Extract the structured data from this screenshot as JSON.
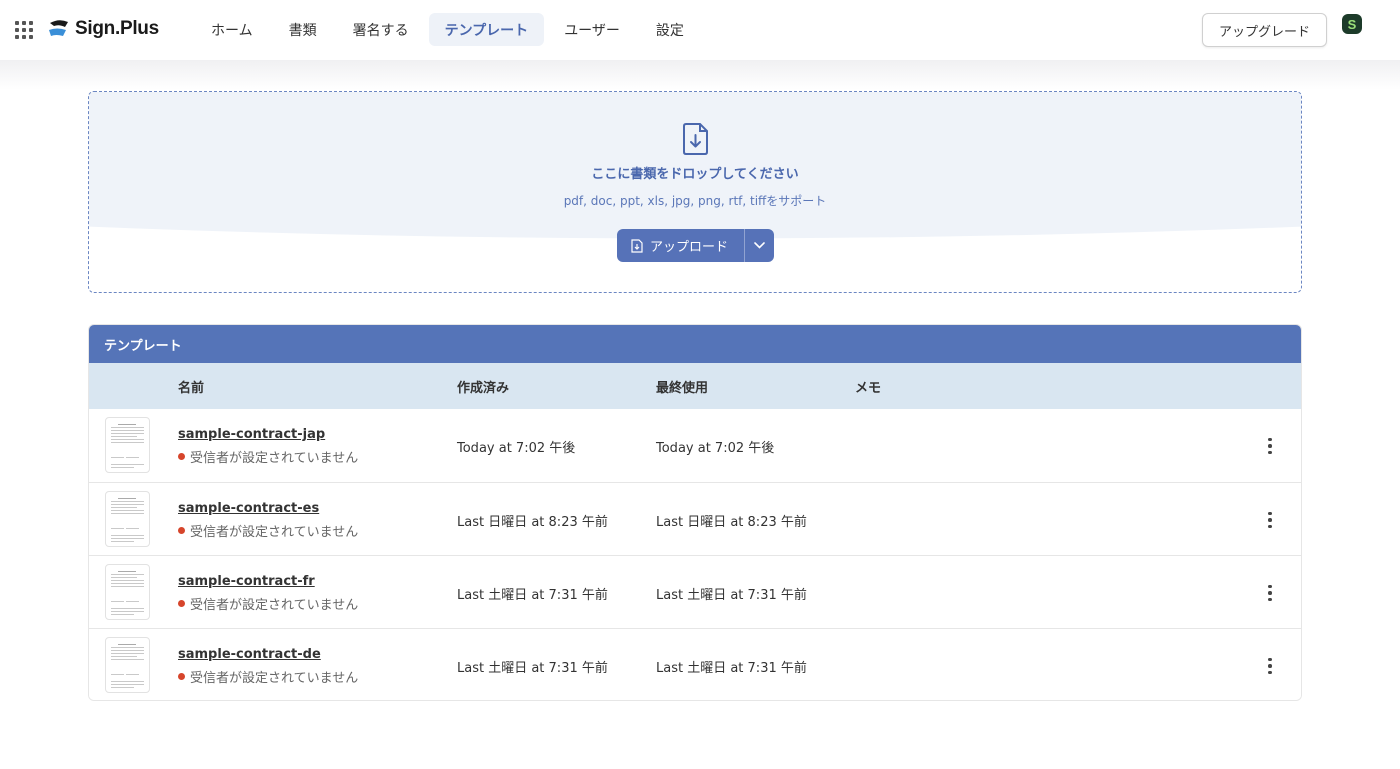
{
  "header": {
    "brand": "Sign.Plus",
    "nav": [
      {
        "label": "ホーム",
        "active": false
      },
      {
        "label": "書類",
        "active": false
      },
      {
        "label": "署名する",
        "active": false
      },
      {
        "label": "テンプレート",
        "active": true
      },
      {
        "label": "ユーザー",
        "active": false
      },
      {
        "label": "設定",
        "active": false
      }
    ],
    "upgrade_label": "アップグレード",
    "avatar_letter": "S",
    "apps_icon": "grid-apps-icon"
  },
  "dropzone": {
    "title": "ここに書類をドロップしてください",
    "supported": "pdf, doc, ppt, xls, jpg, png, rtf, tiffをサポート",
    "upload_label": "アップロード",
    "icon": "file-download-icon"
  },
  "templates": {
    "section_title": "テンプレート",
    "columns": {
      "name": "名前",
      "created": "作成済み",
      "last_used": "最終使用",
      "memo": "メモ"
    },
    "rows": [
      {
        "name": "sample-contract-jap",
        "status": "受信者が設定されていません",
        "created": "Today at 7:02 午後",
        "last_used": "Today at 7:02 午後",
        "memo": ""
      },
      {
        "name": "sample-contract-es",
        "status": "受信者が設定されていません",
        "created": "Last 日曜日 at 8:23 午前",
        "last_used": "Last 日曜日 at 8:23 午前",
        "memo": ""
      },
      {
        "name": "sample-contract-fr",
        "status": "受信者が設定されていません",
        "created": "Last 土曜日 at 7:31 午前",
        "last_used": "Last 土曜日 at 7:31 午前",
        "memo": ""
      },
      {
        "name": "sample-contract-de",
        "status": "受信者が設定されていません",
        "created": "Last 土曜日 at 7:31 午前",
        "last_used": "Last 土曜日 at 7:31 午前",
        "memo": ""
      }
    ]
  },
  "colors": {
    "accent": "#5574b8",
    "status_dot": "#d6452b",
    "header_row": "#d9e6f1"
  }
}
